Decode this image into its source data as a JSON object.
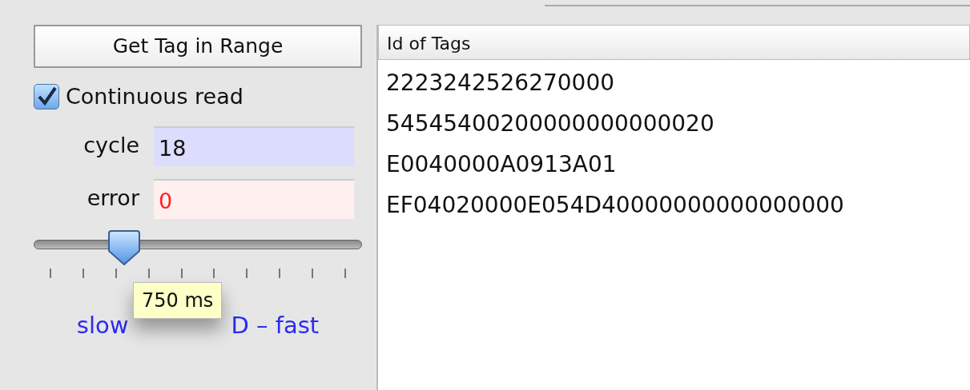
{
  "read_button": {
    "label": "Get Tag in Range"
  },
  "continuous_read": {
    "label": "Continuous read",
    "checked": true
  },
  "fields": [
    {
      "label": "cycle",
      "value": "18",
      "kind": "count"
    },
    {
      "label": "error",
      "value": "0",
      "kind": "error"
    }
  ],
  "speed_slider": {
    "level": 0.25,
    "label_left": "slow",
    "label_right": "D – fast",
    "tooltip": "750 ms"
  },
  "tags_list": {
    "header": "Id of Tags",
    "rows": [
      "2223242526270000",
      "54545400200000000000020",
      "E0040000A0913A01",
      "EF04020000E054D40000000000000000"
    ]
  }
}
